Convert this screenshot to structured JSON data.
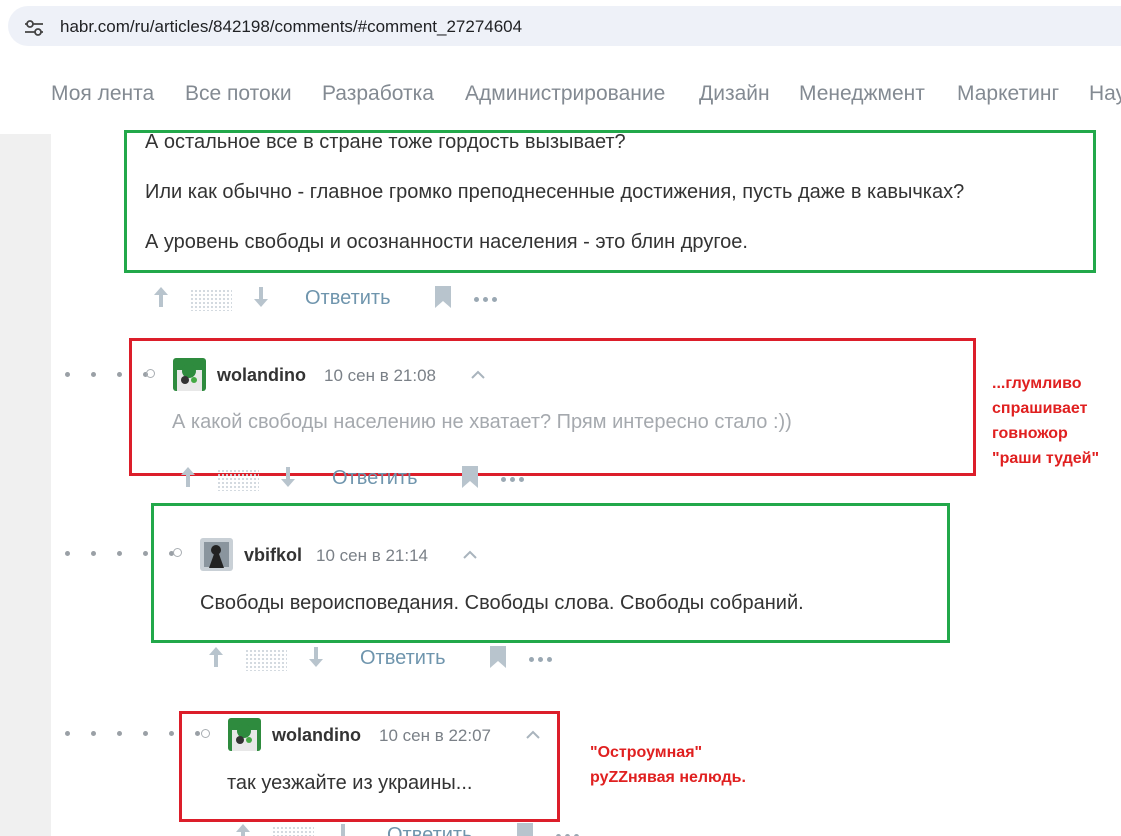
{
  "browser": {
    "url": "habr.com/ru/articles/842198/comments/#comment_27274604"
  },
  "nav": {
    "items": [
      "Моя лента",
      "Все потоки",
      "Разработка",
      "Администрирование",
      "Дизайн",
      "Менеджмент",
      "Маркетинг",
      "Нау"
    ]
  },
  "comment0": {
    "lines": [
      "А остальное все в стране тоже гордость вызывает?",
      "Или как обычно - главное громко преподнесенные достижения, пусть даже в кавычках?",
      "А уровень свободы и осознанности населения - это блин другое."
    ]
  },
  "actions": {
    "reply_label": "Ответить"
  },
  "comment1": {
    "author": "wolandino",
    "time": "10 сен в 21:08",
    "text": "А какой свободы населению не хватает? Прям интересно стало :))"
  },
  "comment2": {
    "author": "vbifkol",
    "time": "10 сен в 21:14",
    "text": "Свободы вероисповедания. Свободы слова. Свободы собраний."
  },
  "comment3": {
    "author": "wolandino",
    "time": "10 сен в 22:07",
    "text": "так уезжайте из украины..."
  },
  "annotations": {
    "first": [
      "...глумливо",
      "спрашивает",
      "говножор",
      "\"раши тудей\""
    ],
    "second": [
      "\"Остроумная\"",
      "руZZнявая нелюдь."
    ]
  },
  "colors": {
    "green_box": "#22a84a",
    "red_box": "#dc1e2a",
    "reply": "#6f95ad"
  }
}
